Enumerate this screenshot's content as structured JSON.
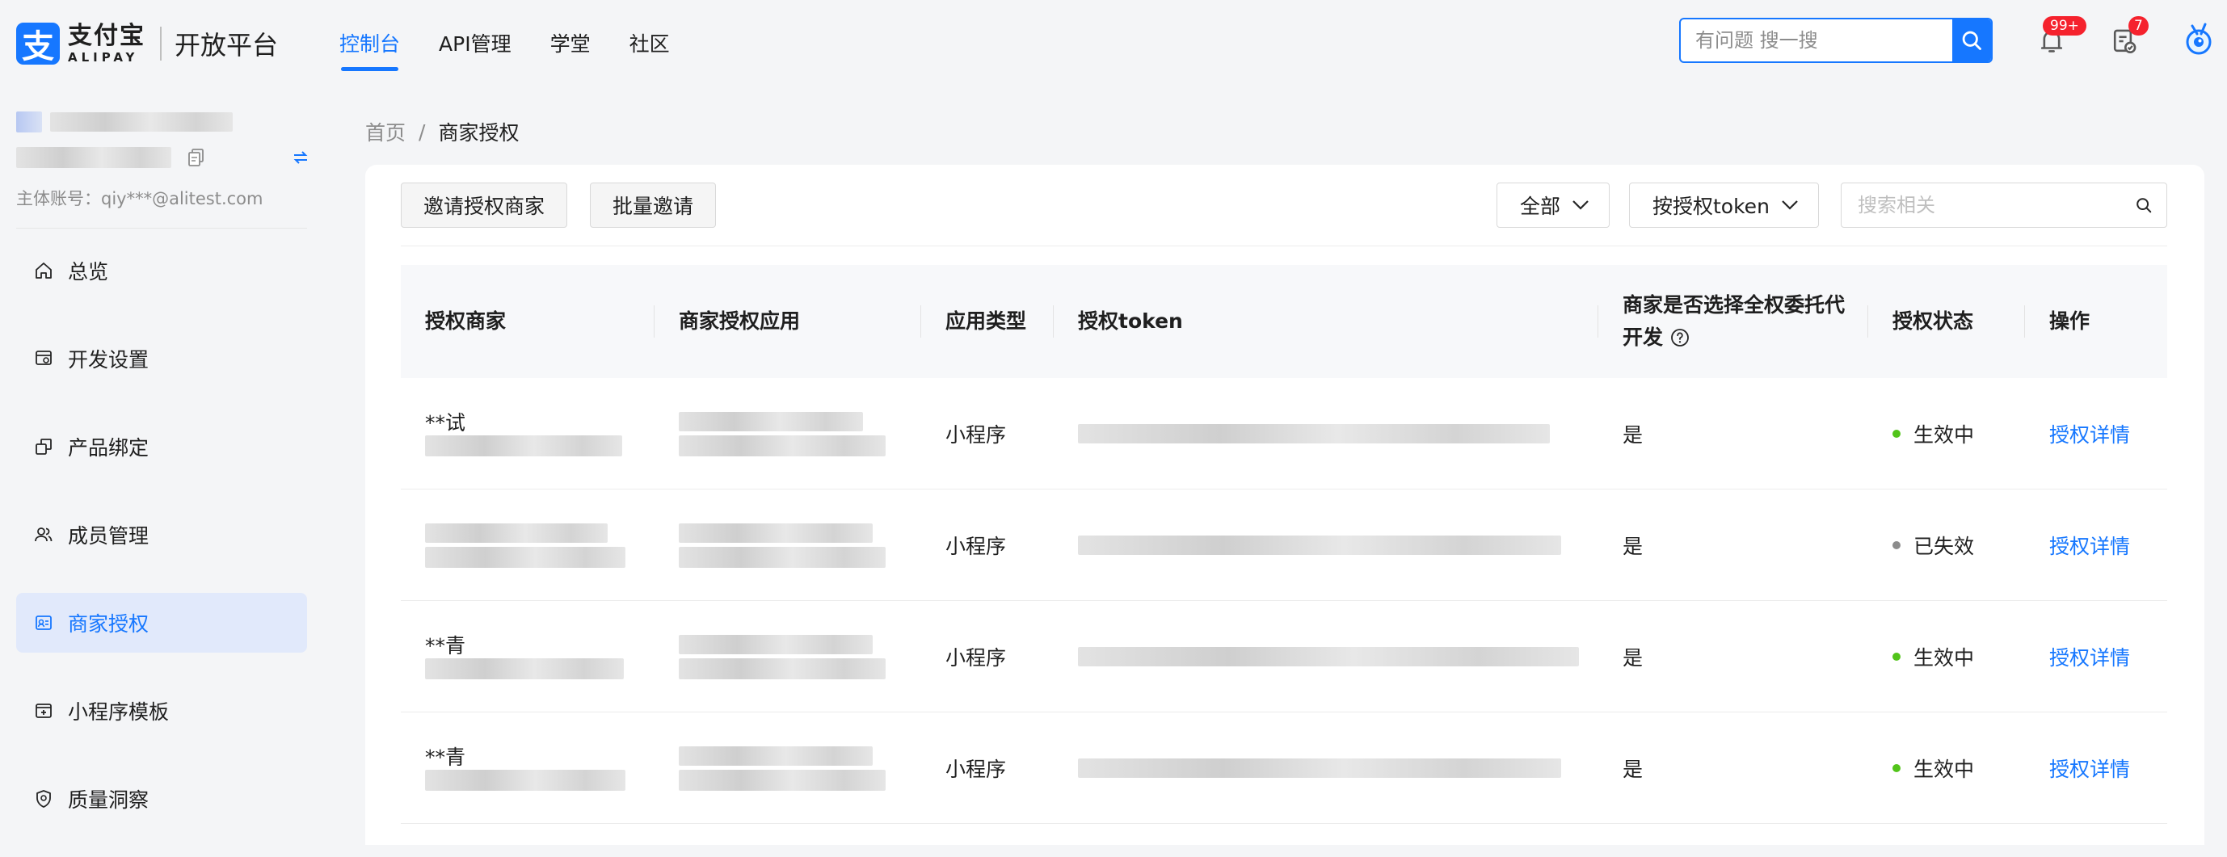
{
  "header": {
    "logo_glyph": "支",
    "logo_cn": "支付宝",
    "logo_en": "ALIPAY",
    "platform": "开放平台",
    "nav": [
      {
        "label": "控制台",
        "active": true
      },
      {
        "label": "API管理",
        "active": false
      },
      {
        "label": "学堂",
        "active": false
      },
      {
        "label": "社区",
        "active": false
      }
    ],
    "search_placeholder": "有问题 搜一搜",
    "notify_badge": "99+",
    "todo_badge": "7"
  },
  "sidebar": {
    "account_label": "主体账号：qiy***@alitest.com",
    "items": [
      {
        "label": "总览",
        "icon": "home-icon",
        "active": false
      },
      {
        "label": "开发设置",
        "icon": "dev-settings-icon",
        "active": false
      },
      {
        "label": "产品绑定",
        "icon": "product-bind-icon",
        "active": false
      },
      {
        "label": "成员管理",
        "icon": "members-icon",
        "active": false
      },
      {
        "label": "商家授权",
        "icon": "merchant-auth-icon",
        "active": true
      },
      {
        "label": "小程序模板",
        "icon": "template-icon",
        "active": false
      },
      {
        "label": "质量洞察",
        "icon": "shield-icon",
        "active": false
      }
    ]
  },
  "breadcrumb": {
    "home": "首页",
    "sep": "/",
    "current": "商家授权"
  },
  "toolbar": {
    "invite_label": "邀请授权商家",
    "batch_label": "批量邀请",
    "filter_value": "全部",
    "sort_value": "按授权token",
    "search_placeholder": "搜索相关"
  },
  "table": {
    "columns": [
      "授权商家",
      "商家授权应用",
      "应用类型",
      "授权token",
      "商家是否选择全权委托代开发",
      "授权状态",
      "操作"
    ],
    "rows": [
      {
        "merchant": "**试",
        "merchant_sub": "",
        "app": "",
        "type": "小程序",
        "token": "",
        "full_delegate": "是",
        "status": "生效中",
        "status_color": "#52c41a",
        "action": "授权详情"
      },
      {
        "merchant": "",
        "merchant_sub": "",
        "app": "",
        "type": "小程序",
        "token": "",
        "full_delegate": "是",
        "status": "已失效",
        "status_color": "#8c8c8c",
        "action": "授权详情"
      },
      {
        "merchant": "**青",
        "merchant_sub": "",
        "app": "",
        "type": "小程序",
        "token": "",
        "full_delegate": "是",
        "status": "生效中",
        "status_color": "#52c41a",
        "action": "授权详情"
      },
      {
        "merchant": "**青",
        "merchant_sub": "",
        "app": "",
        "type": "小程序",
        "token": "",
        "full_delegate": "是",
        "status": "生效中",
        "status_color": "#52c41a",
        "action": "授权详情"
      }
    ]
  },
  "colors": {
    "accent": "#1677ff",
    "active_bg": "#e1e9fb",
    "danger": "#f5222d"
  }
}
